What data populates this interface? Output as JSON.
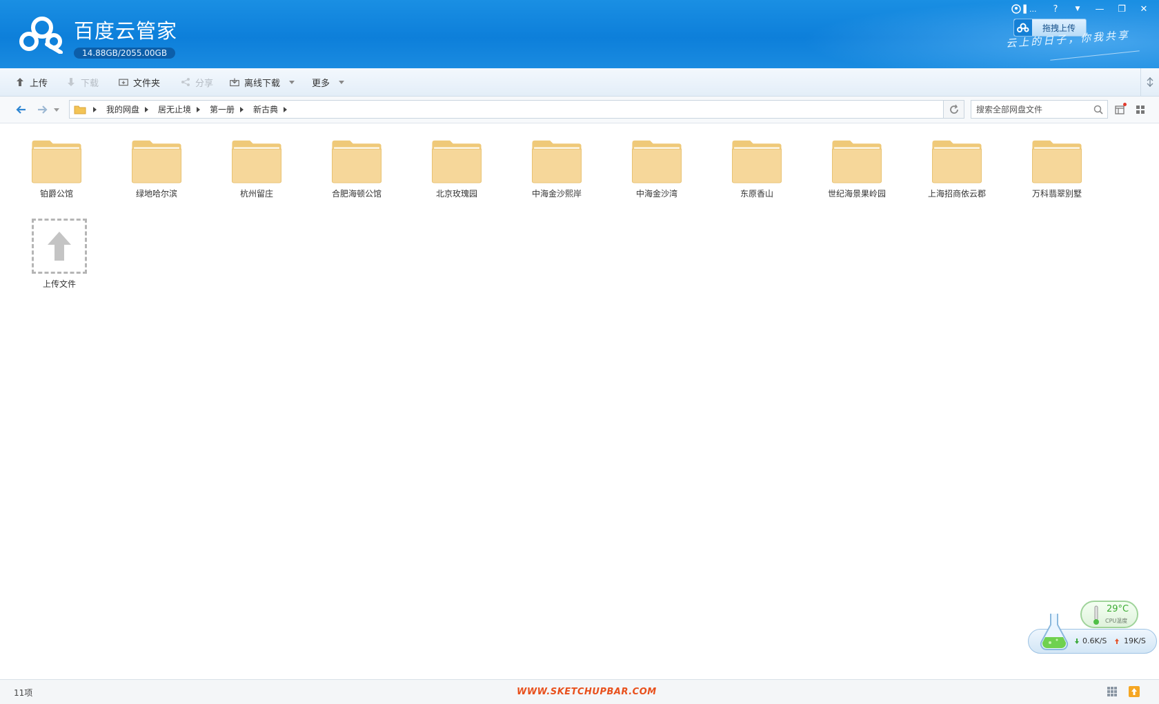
{
  "app": {
    "title": "百度云管家",
    "quota": "14.88GB/2055.00GB",
    "slogan": "云上的日子，你我共享",
    "drag_upload_label": "拖拽上传",
    "window_controls": {
      "user": "▌...",
      "help": "?",
      "menu": "▼",
      "minimize": "—",
      "restore": "❐",
      "close": "✕"
    }
  },
  "toolbar": {
    "upload": "上传",
    "download": "下载",
    "new_folder": "文件夹",
    "share": "分享",
    "offline_download": "离线下载",
    "more": "更多"
  },
  "nav": {
    "breadcrumb": [
      "我的网盘",
      "居无止境",
      "第一册",
      "新古典"
    ],
    "search_placeholder": "搜索全部网盘文件"
  },
  "folders": [
    "铂爵公馆",
    "绿地哈尔滨",
    "杭州留庄",
    "合肥海顿公馆",
    "北京玫瑰园",
    "中海金沙熙岸",
    "中海金沙湾",
    "东原香山",
    "世纪海景果岭园",
    "上海招商依云郡",
    "万科翡翠别墅"
  ],
  "upload_tile_label": "上传文件",
  "widget": {
    "cpu_temp": "29°C",
    "cpu_label": "CPU温度",
    "down_speed": "0.6K/S",
    "up_speed": "19K/S"
  },
  "status": {
    "count": "11项",
    "watermark": "WWW.SKETCHUPBAR.COM"
  },
  "colors": {
    "header_blue": "#0d7fda",
    "folder_fill": "#f6d79a",
    "watermark": "#e8501c"
  }
}
